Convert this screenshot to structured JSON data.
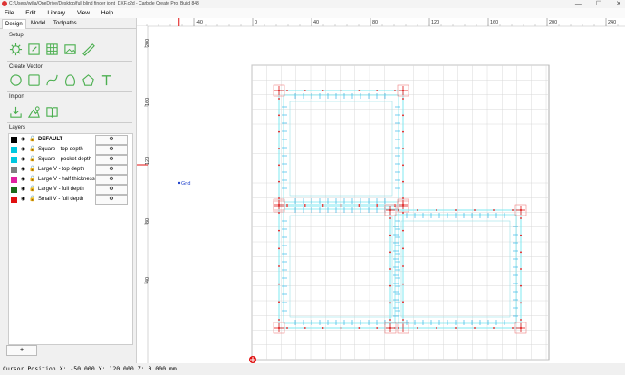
{
  "window": {
    "title": "C:/Users/willa/OneDrive/Desktop/full blind finger joint_DXF.c2d - Carbide Create Pro, Build 843",
    "minimize": "—",
    "maximize": "☐",
    "close": "✕"
  },
  "menu": [
    "File",
    "Edit",
    "Library",
    "View",
    "Help"
  ],
  "tabs": [
    "Design",
    "Model",
    "Toolpaths"
  ],
  "sections": {
    "setup": "Setup",
    "create_vector": "Create Vector",
    "import": "Import",
    "layers": "Layers"
  },
  "layers": [
    {
      "name": "DEFAULT",
      "color": "#000000",
      "bold": true
    },
    {
      "name": "Square - top depth",
      "color": "#00c8e0"
    },
    {
      "name": "Square - pocket depth",
      "color": "#00c8e0"
    },
    {
      "name": "Large V - top depth",
      "color": "#808080"
    },
    {
      "name": "Large V - half thickness",
      "color": "#e020a0"
    },
    {
      "name": "Large V - full depth",
      "color": "#1a6b1a"
    },
    {
      "name": "Small V - full depth",
      "color": "#e01010"
    }
  ],
  "add_layer_label": "+",
  "ruler_top_labels": [
    "-40",
    "0",
    "40",
    "80",
    "120",
    "160",
    "200",
    "240"
  ],
  "ruler_left_labels": [
    "200",
    "160",
    "120",
    "80",
    "40"
  ],
  "grid_label": "Grid",
  "status": "Cursor Position X: -50.000 Y: 120.000 Z: 0.000 mm",
  "colors": {
    "accent_green": "#4caf50",
    "outline_cyan": "#7fe8f0",
    "marker_red": "#e01010",
    "grid": "#d8d8d8"
  }
}
